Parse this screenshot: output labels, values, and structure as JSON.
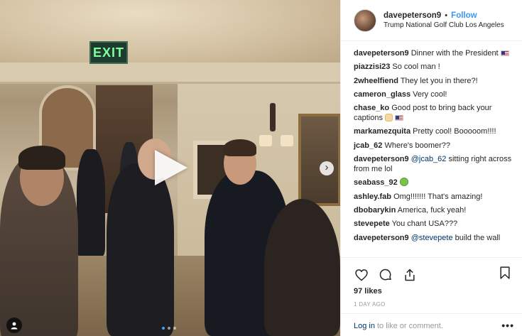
{
  "media": {
    "exit_sign": "EXIT",
    "carousel_dot_count": 3,
    "carousel_active_index": 0
  },
  "post": {
    "username": "davepeterson9",
    "separator": "•",
    "follow_label": "Follow",
    "location": "Trump National Golf Club Los Angeles"
  },
  "comments": [
    {
      "user": "davepeterson9",
      "text": "Dinner with the President",
      "emoji": "us-flag"
    },
    {
      "user": "piazzisi23",
      "text": "So cool man !"
    },
    {
      "user": "2wheelfiend",
      "text": "They let you in there?!"
    },
    {
      "user": "cameron_glass",
      "text": "Very cool!"
    },
    {
      "user": "chase_ko",
      "text": "Good post to bring back your captions",
      "emoji": "raised-hands us-flag"
    },
    {
      "user": "markamezquita",
      "text": "Pretty cool! Booooom!!!!"
    },
    {
      "user": "jcab_62",
      "text": "Where's boomer??"
    },
    {
      "user": "davepeterson9",
      "mention": "@jcab_62",
      "text": "sitting right across from me lol"
    },
    {
      "user": "seabass_92",
      "text": "",
      "emoji": "nauseated-face"
    },
    {
      "user": "ashley.fab",
      "text": "Omg!!!!!!! That's amazing!"
    },
    {
      "user": "dbobarykin",
      "text": "America, fuck yeah!"
    },
    {
      "user": "stevepete",
      "text": "You chant USA???"
    },
    {
      "user": "davepeterson9",
      "mention": "@stevepete",
      "text": "build the wall"
    }
  ],
  "actions": {
    "like_icon": "heart-icon",
    "comment_icon": "comment-icon",
    "share_icon": "share-icon",
    "save_icon": "bookmark-icon",
    "likes": "97 likes",
    "time_ago": "1 DAY AGO",
    "login_link": "Log in",
    "login_text": "to like or comment.",
    "more": "•••"
  },
  "colors": {
    "link_blue": "#3897f0",
    "mention_blue": "#003569",
    "text": "#262626",
    "muted": "#999999"
  }
}
